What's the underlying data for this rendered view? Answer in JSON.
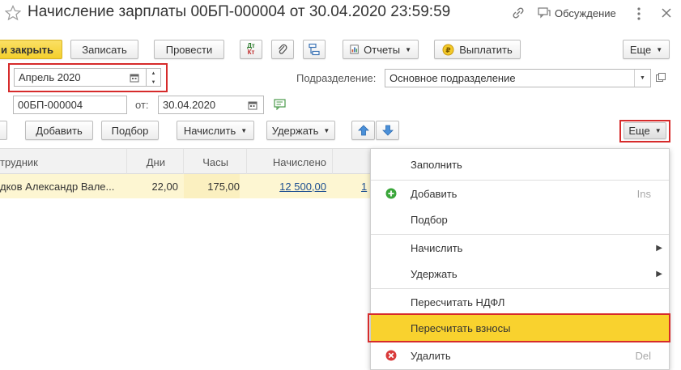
{
  "window": {
    "title": "Начисление зарплаты 00БП-000004 от 30.04.2020 23:59:59",
    "discussion_label": "Обсуждение"
  },
  "toolbar": {
    "post_close_label": "и закрыть",
    "save_label": "Записать",
    "post_label": "Провести",
    "dtkt_label_top": "Дт",
    "dtkt_label_bottom": "Кт",
    "reports_label": "Отчеты",
    "pay_label": "Выплатить",
    "more_label": "Еще"
  },
  "form": {
    "period_value": "Апрель 2020",
    "department_label": "Подразделение:",
    "department_value": "Основное подразделение",
    "number_value": "00БП-000004",
    "date_label": "от:",
    "date_value": "30.04.2020"
  },
  "table_toolbar": {
    "add_label": "Добавить",
    "select_label": "Подбор",
    "accrue_label": "Начислить",
    "withhold_label": "Удержать",
    "more_label": "Еще"
  },
  "table": {
    "columns": [
      "трудник",
      "Дни",
      "Часы",
      "Начислено"
    ],
    "rows": [
      {
        "employee": "дков Александр Вале...",
        "days": "22,00",
        "hours": "175,00",
        "accrued": "12 500,00",
        "extra": "1"
      }
    ]
  },
  "menu": {
    "items": [
      {
        "label": "Заполнить",
        "shortcut": "",
        "icon": "",
        "submenu": false
      },
      {
        "label": "Добавить",
        "shortcut": "Ins",
        "icon": "add-icon",
        "submenu": false
      },
      {
        "label": "Подбор",
        "shortcut": "",
        "icon": "",
        "submenu": false
      },
      {
        "label": "Начислить",
        "shortcut": "",
        "icon": "",
        "submenu": true
      },
      {
        "label": "Удержать",
        "shortcut": "",
        "icon": "",
        "submenu": true
      },
      {
        "label": "Пересчитать НДФЛ",
        "shortcut": "",
        "icon": "",
        "submenu": false
      },
      {
        "label": "Пересчитать взносы",
        "shortcut": "",
        "icon": "",
        "submenu": false
      },
      {
        "label": "Удалить",
        "shortcut": "Del",
        "icon": "delete-icon",
        "submenu": false
      }
    ]
  },
  "colors": {
    "accent_yellow": "#f7d432",
    "highlight_row": "#fdf6d2",
    "menu_highlight": "#f9d22e",
    "annotation_red": "#d62b2b",
    "link_blue": "#1d4f91",
    "arrow_blue": "#4a90d9"
  }
}
